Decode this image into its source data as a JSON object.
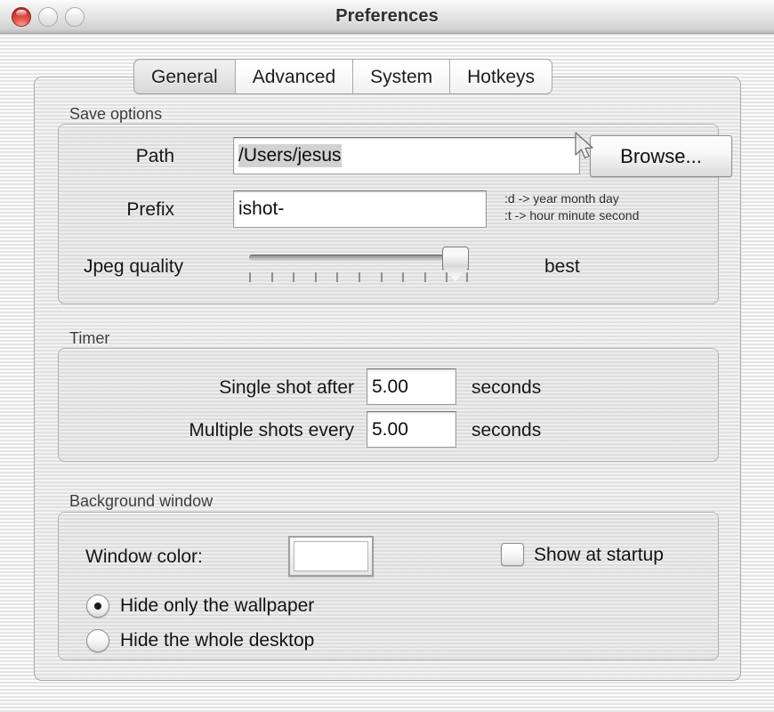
{
  "window": {
    "title": "Preferences",
    "controls": {
      "close": "close-button",
      "minimize": "minimize-button",
      "zoom": "zoom-button"
    }
  },
  "tabs": [
    {
      "label": "General",
      "selected": true
    },
    {
      "label": "Advanced",
      "selected": false
    },
    {
      "label": "System",
      "selected": false
    },
    {
      "label": "Hotkeys",
      "selected": false
    }
  ],
  "save_options": {
    "group_label": "Save options",
    "path": {
      "label": "Path",
      "value": "/Users/jesus",
      "selected": true
    },
    "browse_button": "Browse...",
    "prefix": {
      "label": "Prefix",
      "value": "ishot-"
    },
    "hints": [
      ":d -> year month day",
      ":t -> hour minute second"
    ],
    "jpeg_quality": {
      "label": "Jpeg quality",
      "value_label": "best",
      "value": 100,
      "min": 0,
      "max": 100,
      "ticks": 11
    }
  },
  "timer": {
    "group_label": "Timer",
    "rows": [
      {
        "label": "Single shot after",
        "value": "5.00",
        "unit": "seconds"
      },
      {
        "label": "Multiple shots every",
        "value": "5.00",
        "unit": "seconds"
      }
    ]
  },
  "background_window": {
    "group_label": "Background window",
    "window_color": {
      "label": "Window color:",
      "value": "#ffffff"
    },
    "show_at_startup": {
      "label": "Show at startup",
      "checked": false
    },
    "hide_mode": [
      {
        "label": "Hide only the wallpaper",
        "selected": true
      },
      {
        "label": "Hide the whole desktop",
        "selected": false
      }
    ]
  },
  "colors": {
    "window_bg": "#e8e8e8",
    "panel_bg": "#e4e4e4",
    "group_bg": "#dedede",
    "close_button": "#c0322c",
    "text": "#101010"
  }
}
